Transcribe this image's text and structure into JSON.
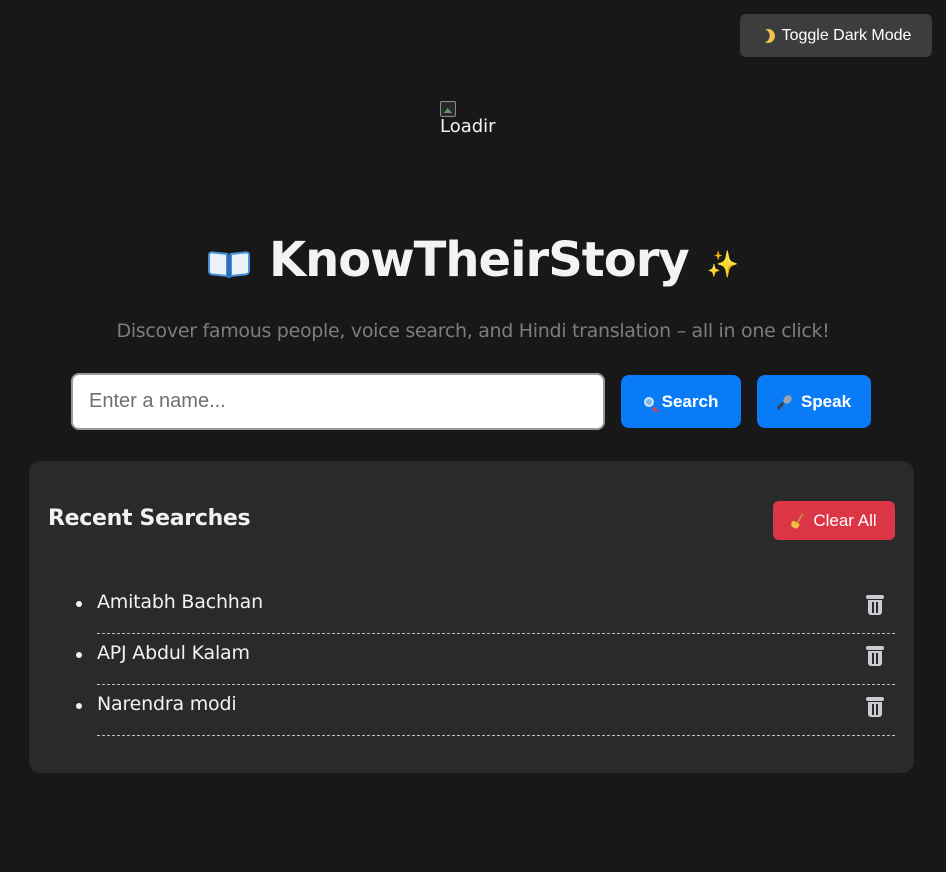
{
  "header": {
    "toggle_label": "Toggle Dark Mode",
    "toggle_icon": "moon-icon"
  },
  "loader": {
    "alt_text": "Loadir"
  },
  "hero": {
    "title": "KnowTheirStory",
    "title_left_icon": "open-book-icon",
    "title_right_icon": "sparkles-icon",
    "subtitle": "Discover famous people, voice search, and Hindi translation – all in one click!"
  },
  "search": {
    "placeholder": "Enter a name...",
    "value": "",
    "search_button": "Search",
    "search_icon": "magnifier-icon",
    "speak_button": "Speak",
    "speak_icon": "microphone-icon"
  },
  "recent": {
    "title": "Recent Searches",
    "clear_label": "Clear All",
    "clear_icon": "broom-icon",
    "items": [
      {
        "name": "Amitabh Bachhan"
      },
      {
        "name": "APJ Abdul Kalam"
      },
      {
        "name": "Narendra modi"
      }
    ],
    "delete_icon": "wastebasket-icon"
  },
  "colors": {
    "background": "#181818",
    "panel": "#2a2a2a",
    "primary_button": "#0a7bf6",
    "danger_button": "#dc3545",
    "toggle_button": "#3d3d3d",
    "subtitle_text": "#7d7d7d"
  }
}
